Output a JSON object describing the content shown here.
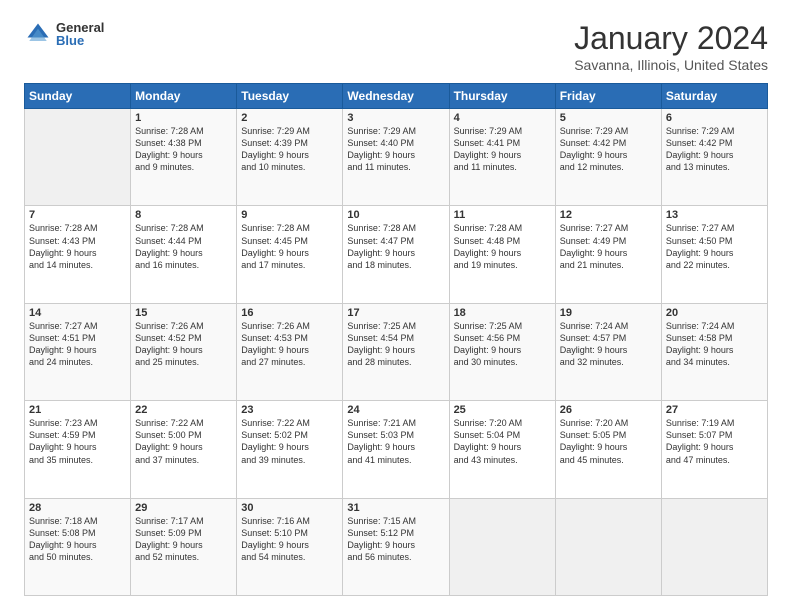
{
  "logo": {
    "general": "General",
    "blue": "Blue"
  },
  "header": {
    "month": "January 2024",
    "location": "Savanna, Illinois, United States"
  },
  "weekdays": [
    "Sunday",
    "Monday",
    "Tuesday",
    "Wednesday",
    "Thursday",
    "Friday",
    "Saturday"
  ],
  "weeks": [
    [
      {
        "day": "",
        "content": ""
      },
      {
        "day": "1",
        "content": "Sunrise: 7:28 AM\nSunset: 4:38 PM\nDaylight: 9 hours\nand 9 minutes."
      },
      {
        "day": "2",
        "content": "Sunrise: 7:29 AM\nSunset: 4:39 PM\nDaylight: 9 hours\nand 10 minutes."
      },
      {
        "day": "3",
        "content": "Sunrise: 7:29 AM\nSunset: 4:40 PM\nDaylight: 9 hours\nand 11 minutes."
      },
      {
        "day": "4",
        "content": "Sunrise: 7:29 AM\nSunset: 4:41 PM\nDaylight: 9 hours\nand 11 minutes."
      },
      {
        "day": "5",
        "content": "Sunrise: 7:29 AM\nSunset: 4:42 PM\nDaylight: 9 hours\nand 12 minutes."
      },
      {
        "day": "6",
        "content": "Sunrise: 7:29 AM\nSunset: 4:42 PM\nDaylight: 9 hours\nand 13 minutes."
      }
    ],
    [
      {
        "day": "7",
        "content": "Sunrise: 7:28 AM\nSunset: 4:43 PM\nDaylight: 9 hours\nand 14 minutes."
      },
      {
        "day": "8",
        "content": "Sunrise: 7:28 AM\nSunset: 4:44 PM\nDaylight: 9 hours\nand 16 minutes."
      },
      {
        "day": "9",
        "content": "Sunrise: 7:28 AM\nSunset: 4:45 PM\nDaylight: 9 hours\nand 17 minutes."
      },
      {
        "day": "10",
        "content": "Sunrise: 7:28 AM\nSunset: 4:47 PM\nDaylight: 9 hours\nand 18 minutes."
      },
      {
        "day": "11",
        "content": "Sunrise: 7:28 AM\nSunset: 4:48 PM\nDaylight: 9 hours\nand 19 minutes."
      },
      {
        "day": "12",
        "content": "Sunrise: 7:27 AM\nSunset: 4:49 PM\nDaylight: 9 hours\nand 21 minutes."
      },
      {
        "day": "13",
        "content": "Sunrise: 7:27 AM\nSunset: 4:50 PM\nDaylight: 9 hours\nand 22 minutes."
      }
    ],
    [
      {
        "day": "14",
        "content": "Sunrise: 7:27 AM\nSunset: 4:51 PM\nDaylight: 9 hours\nand 24 minutes."
      },
      {
        "day": "15",
        "content": "Sunrise: 7:26 AM\nSunset: 4:52 PM\nDaylight: 9 hours\nand 25 minutes."
      },
      {
        "day": "16",
        "content": "Sunrise: 7:26 AM\nSunset: 4:53 PM\nDaylight: 9 hours\nand 27 minutes."
      },
      {
        "day": "17",
        "content": "Sunrise: 7:25 AM\nSunset: 4:54 PM\nDaylight: 9 hours\nand 28 minutes."
      },
      {
        "day": "18",
        "content": "Sunrise: 7:25 AM\nSunset: 4:56 PM\nDaylight: 9 hours\nand 30 minutes."
      },
      {
        "day": "19",
        "content": "Sunrise: 7:24 AM\nSunset: 4:57 PM\nDaylight: 9 hours\nand 32 minutes."
      },
      {
        "day": "20",
        "content": "Sunrise: 7:24 AM\nSunset: 4:58 PM\nDaylight: 9 hours\nand 34 minutes."
      }
    ],
    [
      {
        "day": "21",
        "content": "Sunrise: 7:23 AM\nSunset: 4:59 PM\nDaylight: 9 hours\nand 35 minutes."
      },
      {
        "day": "22",
        "content": "Sunrise: 7:22 AM\nSunset: 5:00 PM\nDaylight: 9 hours\nand 37 minutes."
      },
      {
        "day": "23",
        "content": "Sunrise: 7:22 AM\nSunset: 5:02 PM\nDaylight: 9 hours\nand 39 minutes."
      },
      {
        "day": "24",
        "content": "Sunrise: 7:21 AM\nSunset: 5:03 PM\nDaylight: 9 hours\nand 41 minutes."
      },
      {
        "day": "25",
        "content": "Sunrise: 7:20 AM\nSunset: 5:04 PM\nDaylight: 9 hours\nand 43 minutes."
      },
      {
        "day": "26",
        "content": "Sunrise: 7:20 AM\nSunset: 5:05 PM\nDaylight: 9 hours\nand 45 minutes."
      },
      {
        "day": "27",
        "content": "Sunrise: 7:19 AM\nSunset: 5:07 PM\nDaylight: 9 hours\nand 47 minutes."
      }
    ],
    [
      {
        "day": "28",
        "content": "Sunrise: 7:18 AM\nSunset: 5:08 PM\nDaylight: 9 hours\nand 50 minutes."
      },
      {
        "day": "29",
        "content": "Sunrise: 7:17 AM\nSunset: 5:09 PM\nDaylight: 9 hours\nand 52 minutes."
      },
      {
        "day": "30",
        "content": "Sunrise: 7:16 AM\nSunset: 5:10 PM\nDaylight: 9 hours\nand 54 minutes."
      },
      {
        "day": "31",
        "content": "Sunrise: 7:15 AM\nSunset: 5:12 PM\nDaylight: 9 hours\nand 56 minutes."
      },
      {
        "day": "",
        "content": ""
      },
      {
        "day": "",
        "content": ""
      },
      {
        "day": "",
        "content": ""
      }
    ]
  ]
}
